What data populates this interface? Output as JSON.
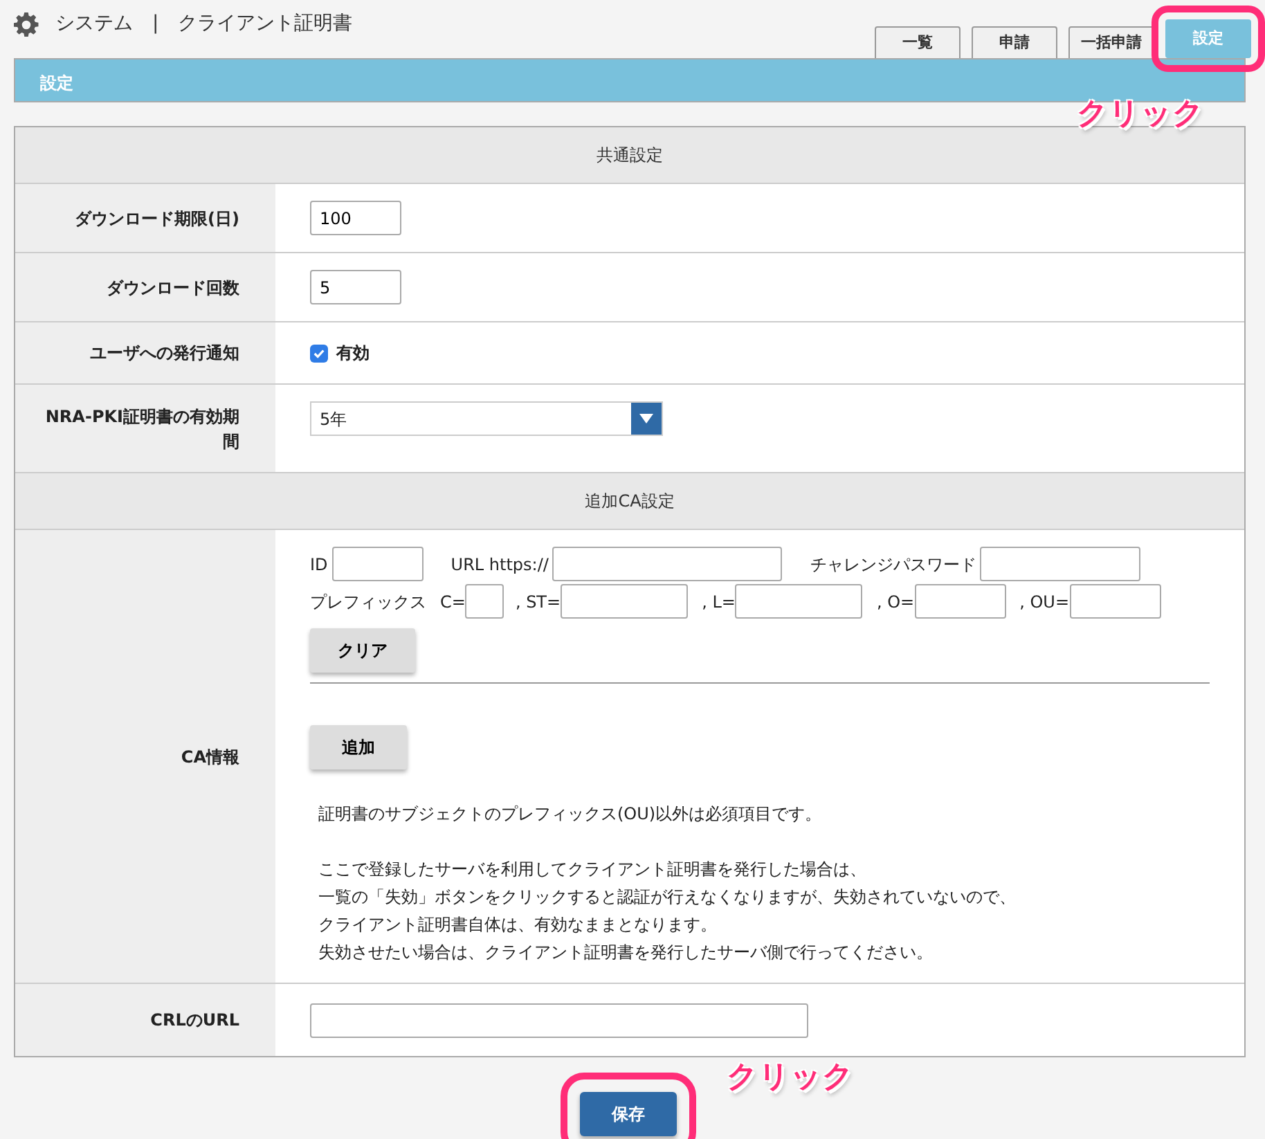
{
  "header": {
    "title": "システム　|　クライアント証明書"
  },
  "tabs": [
    {
      "label": "一覧",
      "selected": false,
      "highlighted": false
    },
    {
      "label": "申請",
      "selected": false,
      "highlighted": false
    },
    {
      "label": "一括申請",
      "selected": false,
      "highlighted": false
    },
    {
      "label": "設定",
      "selected": true,
      "highlighted": true
    }
  ],
  "section_bar": {
    "title": "設定"
  },
  "common_settings": {
    "heading": "共通設定",
    "rows": [
      {
        "kind": "input",
        "label": "ダウンロード期限(日)",
        "value": "100"
      },
      {
        "kind": "input",
        "label": "ダウンロード回数",
        "value": "5"
      },
      {
        "kind": "checkbox",
        "label": "ユーザへの発行通知",
        "option": "有効",
        "checked": true
      },
      {
        "kind": "select",
        "label": "NRA-PKI証明書の有効期間",
        "value": "5年"
      }
    ]
  },
  "ca_settings": {
    "heading": "追加CA設定",
    "label": "CA情報",
    "line_1": [
      {
        "label": "ID"
      },
      {
        "label": "URL https://"
      },
      {
        "label": "チャレンジパスワード"
      }
    ],
    "line_2_label": "プレフィックス",
    "line_2": [
      {
        "label": "C="
      },
      {
        "label": ", ST="
      },
      {
        "label": ", L="
      },
      {
        "label": ", O="
      },
      {
        "label": ", OU="
      }
    ],
    "clear_button": "クリア",
    "add_button": "追加",
    "notes": [
      [
        "証明書のサブジェクトのプレフィックス(OU)以外は必須項目です。"
      ],
      [
        "ここで登録したサーバを利用してクライアント証明書を発行した場合は、",
        "一覧の「失効」ボタンをクリックすると認証が行えなくなりますが、失効されていないので、",
        "クライアント証明書自体は、有効なままとなります。",
        "失効させたい場合は、クライアント証明書を発行したサーバ側で行ってください。"
      ]
    ]
  },
  "crl": {
    "label": "CRLのURL"
  },
  "save_button": {
    "label": "保存",
    "highlighted": true
  },
  "annotations": [
    {
      "text": "クリック"
    },
    {
      "text": "クリック"
    }
  ]
}
